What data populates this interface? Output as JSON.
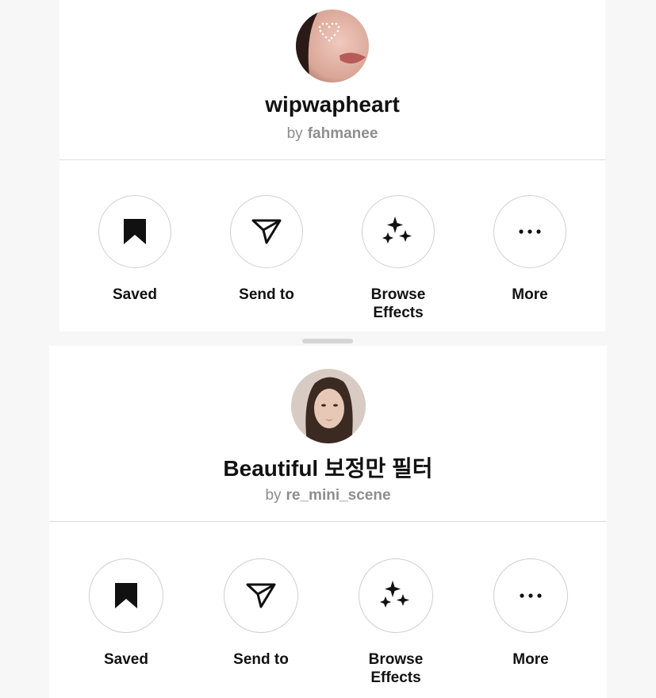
{
  "effects": [
    {
      "title": "wipwapheart",
      "by_prefix": "by",
      "author": "fahmanee",
      "actions": [
        {
          "icon": "bookmark-icon",
          "label": "Saved"
        },
        {
          "icon": "send-icon",
          "label": "Send to"
        },
        {
          "icon": "sparkles-icon",
          "label": "Browse Effects"
        },
        {
          "icon": "more-icon",
          "label": "More"
        }
      ]
    },
    {
      "title": "Beautiful 보정만 필터",
      "by_prefix": "by",
      "author": "re_mini_scene",
      "actions": [
        {
          "icon": "bookmark-icon",
          "label": "Saved"
        },
        {
          "icon": "send-icon",
          "label": "Send to"
        },
        {
          "icon": "sparkles-icon",
          "label": "Browse Effects"
        },
        {
          "icon": "more-icon",
          "label": "More"
        }
      ]
    }
  ]
}
